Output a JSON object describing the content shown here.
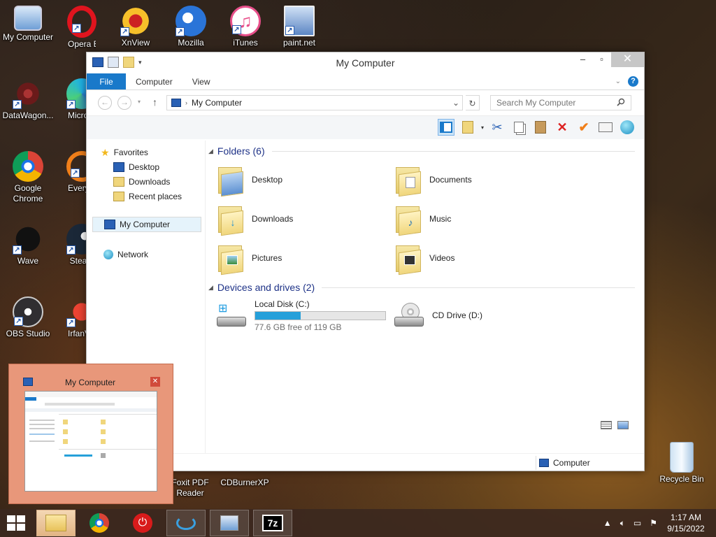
{
  "desktop": {
    "icons": [
      {
        "label": "My Computer"
      },
      {
        "label": "Opera Browser"
      },
      {
        "label": "XnView"
      },
      {
        "label": "Mozilla"
      },
      {
        "label": "iTunes"
      },
      {
        "label": "paint.net"
      },
      {
        "label": "DataWagon..."
      },
      {
        "label": "Microsoft Edge"
      },
      {
        "label": "Google Chrome"
      },
      {
        "label": "Everything"
      },
      {
        "label": "Wave"
      },
      {
        "label": "Steam"
      },
      {
        "label": "OBS Studio"
      },
      {
        "label": "IrfanView"
      },
      {
        "label": "Foxit PDF Reader"
      },
      {
        "label": "CDBurnerXP"
      },
      {
        "label": "Recycle Bin"
      }
    ]
  },
  "window": {
    "title": "My Computer",
    "ribbon_tabs": [
      "File",
      "Computer",
      "View"
    ],
    "address": "My Computer",
    "search_placeholder": "Search My Computer",
    "nav": {
      "favorites": "Favorites",
      "desktop": "Desktop",
      "downloads": "Downloads",
      "recent": "Recent places",
      "my_computer": "My Computer",
      "network": "Network"
    },
    "folders_header": "Folders (6)",
    "folders": [
      {
        "name": "Desktop"
      },
      {
        "name": "Documents"
      },
      {
        "name": "Downloads"
      },
      {
        "name": "Music"
      },
      {
        "name": "Pictures"
      },
      {
        "name": "Videos"
      }
    ],
    "drives_header": "Devices and drives (2)",
    "drives": [
      {
        "name": "Local Disk (C:)",
        "free_text": "77.6 GB free of 119 GB",
        "used_fraction": 0.35
      },
      {
        "name": "CD Drive (D:)"
      }
    ],
    "status_location": "Computer"
  },
  "thumbnail": {
    "title": "My Computer"
  },
  "taskbar": {
    "time": "1:17 AM",
    "date": "9/15/2022"
  },
  "colors": {
    "accent": "#1979ca",
    "header_text": "#1e3287",
    "drive_fill": "#26a0da"
  }
}
